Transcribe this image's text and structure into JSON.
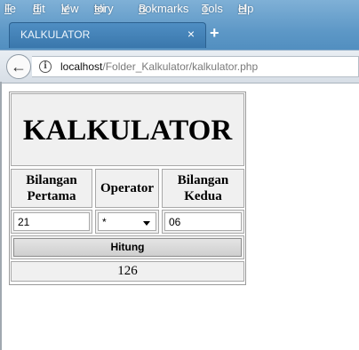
{
  "browser": {
    "menu": [
      {
        "pre": "",
        "u": "F",
        "post": "ile"
      },
      {
        "pre": "",
        "u": "E",
        "post": "dit"
      },
      {
        "pre": "",
        "u": "V",
        "post": "iew"
      },
      {
        "pre": "Hi",
        "u": "s",
        "post": "tory"
      },
      {
        "pre": "",
        "u": "B",
        "post": "ookmarks"
      },
      {
        "pre": "",
        "u": "T",
        "post": "ools"
      },
      {
        "pre": "",
        "u": "H",
        "post": "elp"
      }
    ],
    "tab_title": "KALKULATOR",
    "tab_close": "×",
    "new_tab": "+",
    "back": "←",
    "info": "i",
    "url_host": "localhost",
    "url_path": "/Folder_Kalkulator/kalkulator.php"
  },
  "calculator": {
    "title": "KALKULATOR",
    "col1_line1": "Bilangan",
    "col1_line2": "Pertama",
    "col2": "Operator",
    "col3_line1": "Bilangan",
    "col3_line2": "Kedua",
    "input1_value": "21",
    "operator_value": "*",
    "input2_value": "06",
    "button_label": "Hitung",
    "result": "126"
  },
  "colors": {
    "chrome_blue": "#5c97c6",
    "cell_bg": "#f0f0f0"
  }
}
